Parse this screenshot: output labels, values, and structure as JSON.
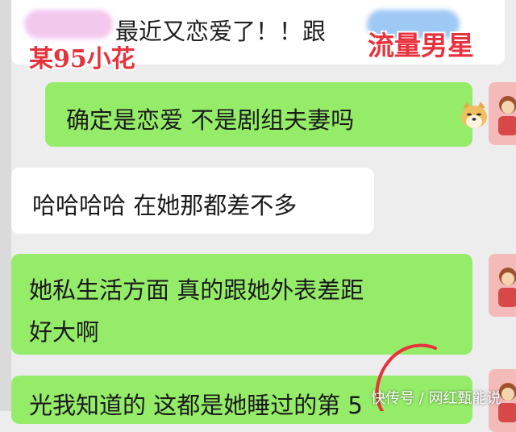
{
  "messages": {
    "top": {
      "text": "最近又恋爱了！！跟"
    },
    "m1": {
      "text": "确定是恋爱 不是剧组夫妻吗",
      "emoji": "doge-icon"
    },
    "m2": {
      "text": "哈哈哈哈 在她那都差不多"
    },
    "m3": {
      "line1": "她私生活方面 真的跟她外表差距",
      "line2": "好大啊"
    },
    "m4": {
      "text": "光我知道的 这都是她睡过的第 5"
    }
  },
  "overlays": {
    "left_label": "某95小花",
    "right_label": "流量男星"
  },
  "watermark": "快传号 / 网红甄能说",
  "colors": {
    "outgoing_bubble": "#95ec69",
    "incoming_bubble": "#ffffff",
    "overlay_red": "#e8323d",
    "background": "#ededed"
  }
}
